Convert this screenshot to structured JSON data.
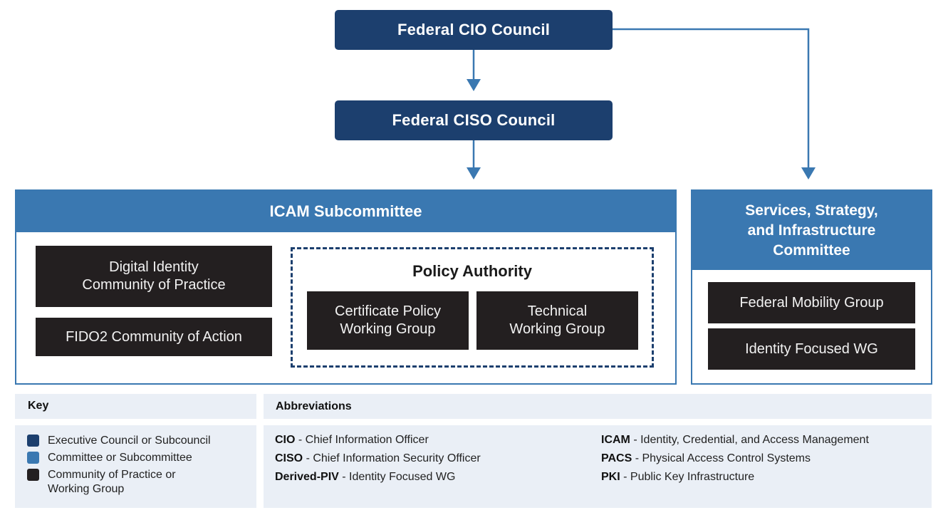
{
  "colors": {
    "executive": "#1c3f6e",
    "committee": "#3a78b1",
    "working_group": "#231f20",
    "panel_bg": "#eaeff6",
    "connector": "#3a78b1"
  },
  "nodes": {
    "cio_council": "Federal CIO Council",
    "ciso_council": "Federal CISO Council",
    "icam": {
      "title": "ICAM Subcommittee",
      "groups": {
        "digital_identity": "Digital Identity\nCommunity of Practice",
        "fido2": "FIDO2 Community of Action"
      },
      "policy_authority": {
        "title": "Policy Authority",
        "groups": {
          "cert_policy": "Certificate Policy\nWorking Group",
          "technical": "Technical\nWorking Group"
        }
      }
    },
    "ssi": {
      "title": "Services, Strategy,\nand Infrastructure\nCommittee",
      "groups": {
        "mobility": "Federal Mobility Group",
        "identity_wg": "Identity Focused WG"
      }
    }
  },
  "edges": [
    {
      "from": "Federal CIO Council",
      "to": "Federal CISO Council"
    },
    {
      "from": "Federal CISO Council",
      "to": "ICAM Subcommittee"
    },
    {
      "from": "Federal CIO Council",
      "to": "Services, Strategy, and Infrastructure Committee"
    }
  ],
  "key": {
    "title": "Key",
    "items": [
      {
        "label": "Executive Council or Subcouncil",
        "color": "#1c3f6e"
      },
      {
        "label": "Committee or Subcommittee",
        "color": "#3a78b1"
      },
      {
        "label": "Community of Practice or\nWorking Group",
        "color": "#231f20"
      }
    ]
  },
  "abbreviations": {
    "title": "Abbreviations",
    "left": [
      {
        "abbr": "CIO",
        "meaning": "Chief Information Officer"
      },
      {
        "abbr": "CISO",
        "meaning": "Chief Information Security Officer"
      },
      {
        "abbr": "Derived-PIV",
        "meaning": "Identity Focused WG"
      }
    ],
    "right": [
      {
        "abbr": "ICAM",
        "meaning": "Identity, Credential, and Access Management"
      },
      {
        "abbr": "PACS",
        "meaning": "Physical Access Control Systems"
      },
      {
        "abbr": "PKI",
        "meaning": "Public Key Infrastructure"
      }
    ],
    "separator": " - "
  }
}
